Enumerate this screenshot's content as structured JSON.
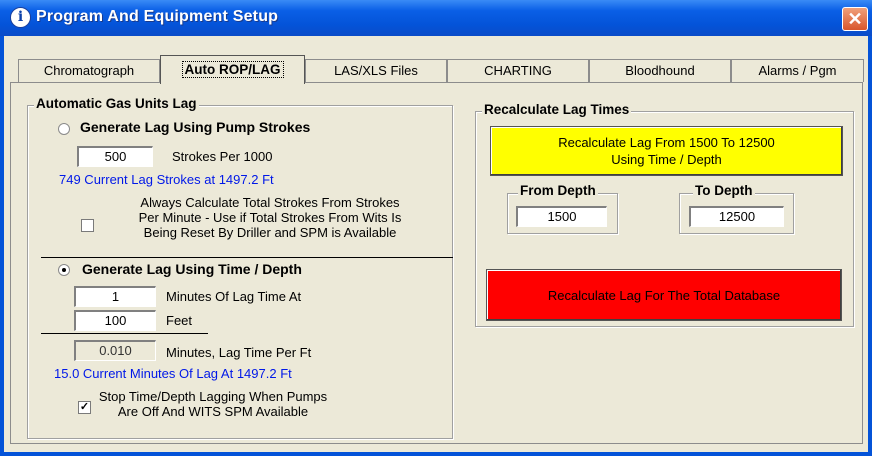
{
  "window": {
    "title": "Program And Equipment Setup",
    "icon": "info-icon",
    "close_glyph": "✕"
  },
  "tabs": [
    {
      "label": "Chromatograph",
      "active": false
    },
    {
      "label": "Auto ROP/LAG",
      "active": true
    },
    {
      "label": "LAS/XLS Files",
      "active": false
    },
    {
      "label": "CHARTING",
      "active": false
    },
    {
      "label": "Bloodhound",
      "active": false
    },
    {
      "label": "Alarms / Pgm",
      "active": false
    }
  ],
  "gas_lag": {
    "title": "Automatic Gas Units Lag",
    "pump_strokes": {
      "label": "Generate Lag Using Pump Strokes",
      "selected": false,
      "strokes_value": "500",
      "strokes_label": "Strokes Per 1000",
      "current_info": "749 Current Lag Strokes at 1497.2 Ft",
      "always_calc_checked": false,
      "always_calc_lines": [
        "Always Calculate Total Strokes From Strokes",
        "Per Minute - Use if Total Strokes From Wits Is",
        "Being Reset By Driller and SPM is Available"
      ]
    },
    "time_depth": {
      "label": "Generate Lag Using Time / Depth",
      "selected": true,
      "minutes_value": "1",
      "minutes_label": "Minutes Of Lag Time At",
      "feet_value": "100",
      "feet_label": "Feet",
      "per_ft_value": "0.010",
      "per_ft_label": "Minutes, Lag Time Per Ft",
      "current_info": "15.0 Current Minutes Of Lag At 1497.2 Ft",
      "stop_checked": true,
      "stop_lines": [
        "Stop Time/Depth Lagging When Pumps",
        "Are Off  And WITS SPM Available"
      ]
    }
  },
  "recalc": {
    "title": "Recalculate Lag Times",
    "range_button_lines": [
      "Recalculate Lag From 1500 To 12500",
      "Using Time / Depth"
    ],
    "range_button_color": "#FFFF00",
    "from_label": "From Depth",
    "from_value": "1500",
    "to_label": "To Depth",
    "to_value": "12500",
    "total_button": "Recalculate Lag For The Total Database",
    "total_button_color": "#FF0000"
  }
}
